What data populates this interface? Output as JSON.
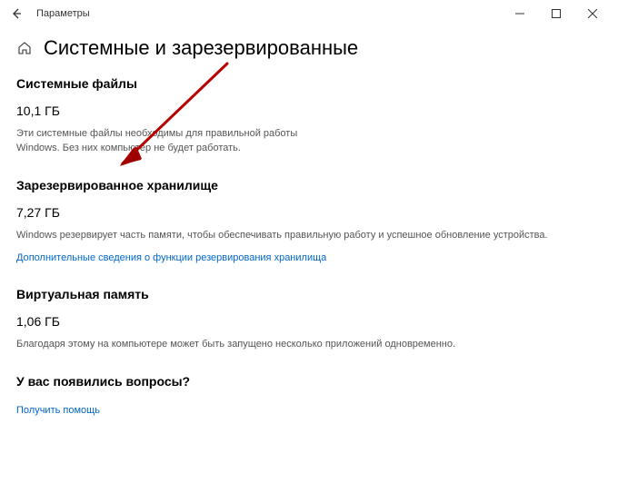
{
  "window": {
    "title": "Параметры"
  },
  "page": {
    "title": "Системные и зарезервированные"
  },
  "sections": {
    "system_files": {
      "heading": "Системные файлы",
      "value": "10,1 ГБ",
      "desc": "Эти системные файлы необходимы для правильной работы Windows. Без них компьютер не будет работать."
    },
    "reserved_storage": {
      "heading": "Зарезервированное хранилище",
      "value": "7,27 ГБ",
      "desc": "Windows резервирует часть памяти, чтобы обеспечивать правильную работу и успешное обновление устройства.",
      "link": "Дополнительные сведения о функции резервирования хранилища"
    },
    "virtual_memory": {
      "heading": "Виртуальная память",
      "value": "1,06 ГБ",
      "desc": "Благодаря этому на компьютере может быть запущено несколько приложений одновременно."
    },
    "help": {
      "heading": "У вас появились вопросы?",
      "link": "Получить помощь"
    }
  }
}
